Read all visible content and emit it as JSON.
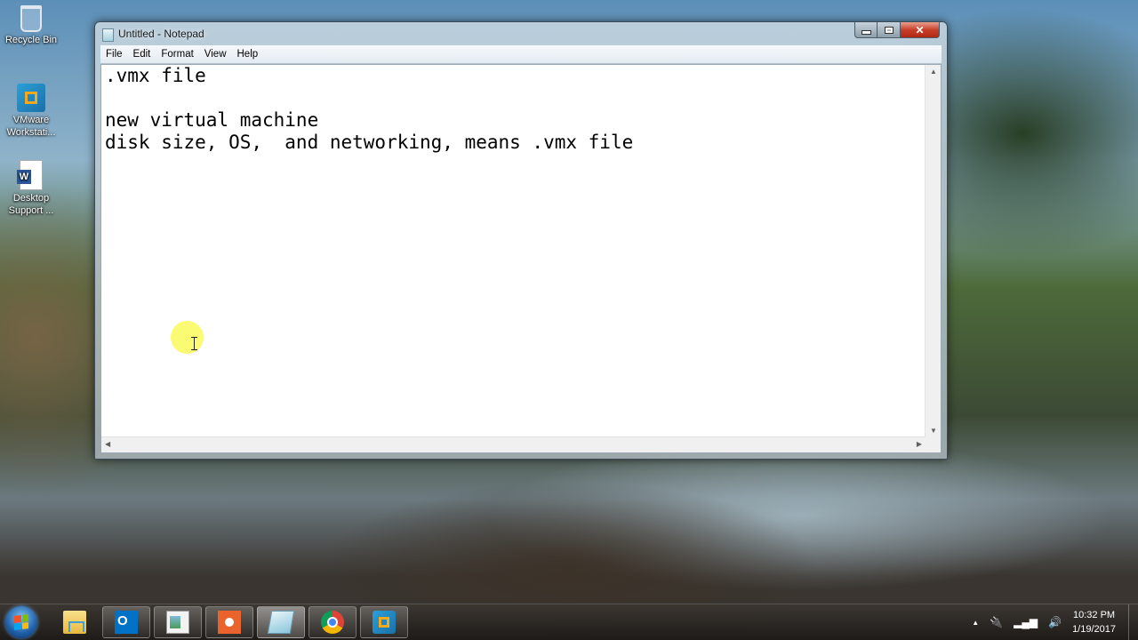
{
  "desktop": {
    "icons": [
      {
        "label": "Recycle Bin",
        "icon": "recycle-bin-icon"
      },
      {
        "label": "VMware Workstati...",
        "icon": "vmware-icon"
      },
      {
        "label": "Desktop Support ...",
        "icon": "word-document-icon"
      }
    ]
  },
  "window": {
    "title": "Untitled - Notepad",
    "menu": [
      "File",
      "Edit",
      "Format",
      "View",
      "Help"
    ],
    "content": {
      "lines": [
        ".vmx file",
        "",
        "new virtual machine",
        "disk size, OS,  and networking, means .vmx file"
      ]
    }
  },
  "taskbar": {
    "items": [
      {
        "name": "file-explorer",
        "icon": "folder-icon"
      },
      {
        "name": "outlook",
        "icon": "outlook-icon"
      },
      {
        "name": "window-app",
        "icon": "window-icon"
      },
      {
        "name": "screen-recorder",
        "icon": "record-icon"
      },
      {
        "name": "notepad",
        "icon": "notepad-icon"
      },
      {
        "name": "chrome",
        "icon": "chrome-icon"
      },
      {
        "name": "vmware-workstation",
        "icon": "vmware-icon"
      }
    ],
    "tray": {
      "show_hidden": "▲",
      "clock_time": "10:32 PM",
      "clock_date": "1/19/2017"
    }
  }
}
